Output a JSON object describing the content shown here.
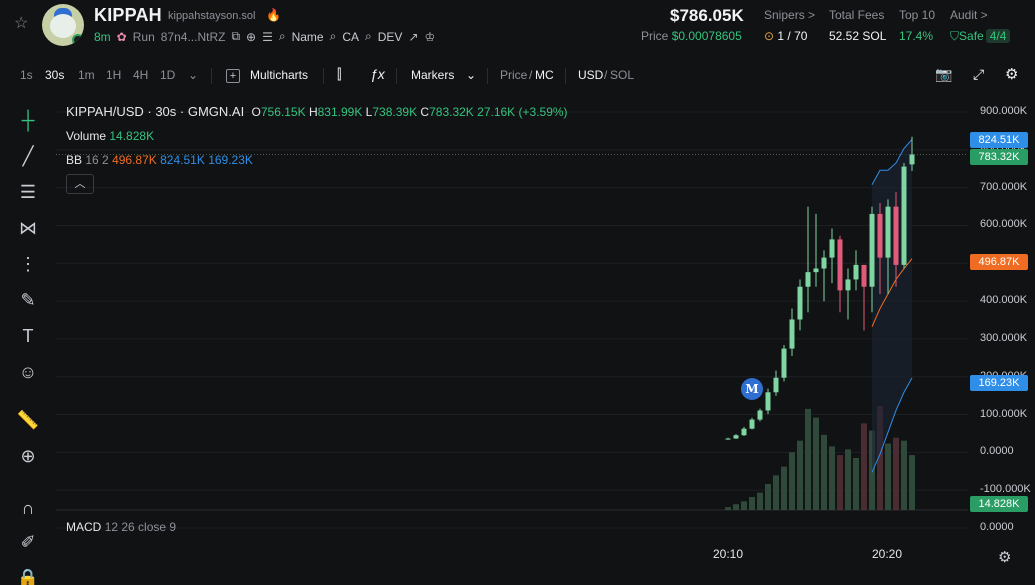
{
  "token": {
    "symbol": "KIPPAH",
    "domain": "kippahstayson.sol",
    "age": "8m",
    "run_label": "Run",
    "address": "87n4...NtRZ",
    "name_label": "Name",
    "ca_label": "CA",
    "dev_label": "DEV"
  },
  "stats": {
    "market_cap": "$786.05K",
    "price_label": "Price",
    "price": "$0.00078605",
    "snipers_label": "Snipers >",
    "snipers": "1 / 70",
    "total_fees_label": "Total Fees",
    "total_fees": "52.52 SOL",
    "top10_label": "Top 10",
    "top10": "17.4%",
    "audit_label": "Audit >",
    "audit_status": "Safe",
    "audit_score": "4/4"
  },
  "toolbar": {
    "intervals": [
      "1s",
      "30s",
      "1m",
      "1H",
      "4H",
      "1D"
    ],
    "active_interval": "30s",
    "multicharts": "Multicharts",
    "markers": "Markers",
    "price_label": "Price",
    "mc_label": "MC",
    "usd_label": "USD",
    "sol_label": "SOL"
  },
  "legend": {
    "pair": "KIPPAH/USD · 30s · GMGN.AI",
    "o_label": "O",
    "o": "756.15K",
    "h_label": "H",
    "h": "831.99K",
    "l_label": "L",
    "l": "738.39K",
    "c_label": "C",
    "c": "783.32K",
    "change": "27.16K (+3.59%)",
    "volume_label": "Volume",
    "volume": "14.828K",
    "bb_label": "BB",
    "bb_params": "16 2",
    "bb_mid": "496.87K",
    "bb_upper": "824.51K",
    "bb_lower": "169.23K",
    "macd_label": "MACD",
    "macd_params": "12 26 close 9"
  },
  "marker_badge": "M",
  "chart_data": {
    "type": "candlestick",
    "y_axis_ticks": [
      "900.000K",
      "800.000K",
      "700.000K",
      "600.000K",
      "500.000K",
      "400.000K",
      "300.000K",
      "200.000K",
      "100.000K",
      "0.0000",
      "-100.000K",
      "0.0000"
    ],
    "ylim": [
      -100000,
      900000
    ],
    "x_ticks": [
      "20:10",
      "20:20"
    ],
    "price_tags": [
      {
        "value": "824.51K",
        "color": "#2f8ee8"
      },
      {
        "value": "783.32K",
        "color": "#2a9d64"
      },
      {
        "value": "496.87K",
        "color": "#ef6c22"
      },
      {
        "value": "169.23K",
        "color": "#2f8ee8"
      },
      {
        "value": "14.828K",
        "color": "#2a9d64"
      }
    ],
    "candles": [
      {
        "o": 0,
        "h": 5000,
        "l": 0,
        "c": 3000
      },
      {
        "o": 3000,
        "h": 15000,
        "l": 2000,
        "c": 12000
      },
      {
        "o": 12000,
        "h": 35000,
        "l": 10000,
        "c": 30000
      },
      {
        "o": 30000,
        "h": 60000,
        "l": 28000,
        "c": 55000
      },
      {
        "o": 55000,
        "h": 85000,
        "l": 50000,
        "c": 80000
      },
      {
        "o": 80000,
        "h": 140000,
        "l": 70000,
        "c": 130000
      },
      {
        "o": 130000,
        "h": 190000,
        "l": 120000,
        "c": 170000
      },
      {
        "o": 170000,
        "h": 260000,
        "l": 160000,
        "c": 250000
      },
      {
        "o": 250000,
        "h": 360000,
        "l": 230000,
        "c": 330000
      },
      {
        "o": 330000,
        "h": 440000,
        "l": 300000,
        "c": 420000
      },
      {
        "o": 420000,
        "h": 640000,
        "l": 350000,
        "c": 460000
      },
      {
        "o": 460000,
        "h": 620000,
        "l": 420000,
        "c": 470000
      },
      {
        "o": 470000,
        "h": 520000,
        "l": 380000,
        "c": 500000
      },
      {
        "o": 500000,
        "h": 580000,
        "l": 430000,
        "c": 550000
      },
      {
        "o": 550000,
        "h": 560000,
        "l": 350000,
        "c": 410000
      },
      {
        "o": 410000,
        "h": 470000,
        "l": 330000,
        "c": 440000
      },
      {
        "o": 440000,
        "h": 520000,
        "l": 410000,
        "c": 480000
      },
      {
        "o": 480000,
        "h": 470000,
        "l": 300000,
        "c": 420000
      },
      {
        "o": 420000,
        "h": 640000,
        "l": 350000,
        "c": 620000
      },
      {
        "o": 620000,
        "h": 650000,
        "l": 400000,
        "c": 500000
      },
      {
        "o": 500000,
        "h": 660000,
        "l": 400000,
        "c": 640000
      },
      {
        "o": 640000,
        "h": 680000,
        "l": 420000,
        "c": 480000
      },
      {
        "o": 480000,
        "h": 760000,
        "l": 470000,
        "c": 750000
      },
      {
        "o": 756150,
        "h": 831990,
        "l": 738390,
        "c": 783320
      }
    ],
    "volumes": [
      2,
      4,
      6,
      9,
      12,
      18,
      24,
      30,
      40,
      48,
      70,
      64,
      52,
      44,
      38,
      42,
      36,
      60,
      55,
      72,
      46,
      50,
      48,
      38
    ],
    "bollinger": {
      "upper": [
        700000,
        740000,
        740000,
        760000,
        800000,
        824510
      ],
      "middle": [
        310000,
        360000,
        400000,
        440000,
        470000,
        496870
      ],
      "lower": [
        -90000,
        -40000,
        20000,
        80000,
        130000,
        169230
      ]
    }
  }
}
